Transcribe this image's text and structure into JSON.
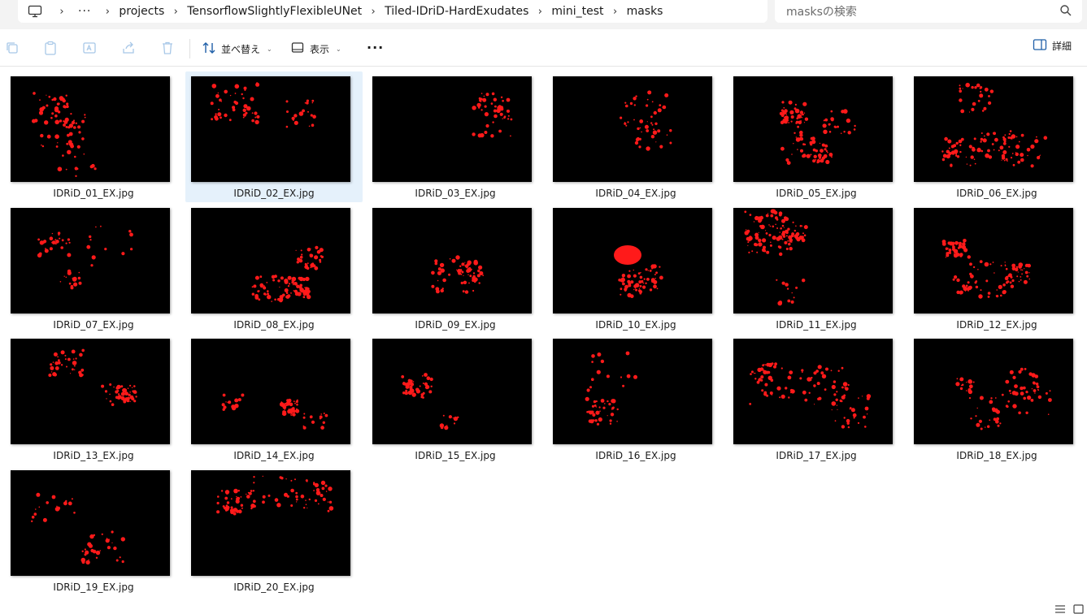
{
  "breadcrumb": {
    "ellipsis": "···",
    "segments": [
      "projects",
      "TensorflowSlightlyFlexibleUNet",
      "Tiled-IDriD-HardExudates",
      "mini_test",
      "masks"
    ]
  },
  "search": {
    "placeholder": "masksの検索"
  },
  "toolbar": {
    "sort_label": "並べ替え",
    "view_label": "表示",
    "details_label": "詳細"
  },
  "files": [
    {
      "name": "IDRiD_01_EX.jpg",
      "selected": false
    },
    {
      "name": "IDRiD_02_EX.jpg",
      "selected": true
    },
    {
      "name": "IDRiD_03_EX.jpg",
      "selected": false
    },
    {
      "name": "IDRiD_04_EX.jpg",
      "selected": false
    },
    {
      "name": "IDRiD_05_EX.jpg",
      "selected": false
    },
    {
      "name": "IDRiD_06_EX.jpg",
      "selected": false
    },
    {
      "name": "IDRiD_07_EX.jpg",
      "selected": false
    },
    {
      "name": "IDRiD_08_EX.jpg",
      "selected": false
    },
    {
      "name": "IDRiD_09_EX.jpg",
      "selected": false
    },
    {
      "name": "IDRiD_10_EX.jpg",
      "selected": false
    },
    {
      "name": "IDRiD_11_EX.jpg",
      "selected": false
    },
    {
      "name": "IDRiD_12_EX.jpg",
      "selected": false
    },
    {
      "name": "IDRiD_13_EX.jpg",
      "selected": false
    },
    {
      "name": "IDRiD_14_EX.jpg",
      "selected": false
    },
    {
      "name": "IDRiD_15_EX.jpg",
      "selected": false
    },
    {
      "name": "IDRiD_16_EX.jpg",
      "selected": false
    },
    {
      "name": "IDRiD_17_EX.jpg",
      "selected": false
    },
    {
      "name": "IDRiD_18_EX.jpg",
      "selected": false
    },
    {
      "name": "IDRiD_19_EX.jpg",
      "selected": false
    },
    {
      "name": "IDRiD_20_EX.jpg",
      "selected": false
    }
  ],
  "colors": {
    "lesion": "#ff1a1a",
    "selection": "#e5f1fb",
    "thumb_bg": "#000000"
  }
}
